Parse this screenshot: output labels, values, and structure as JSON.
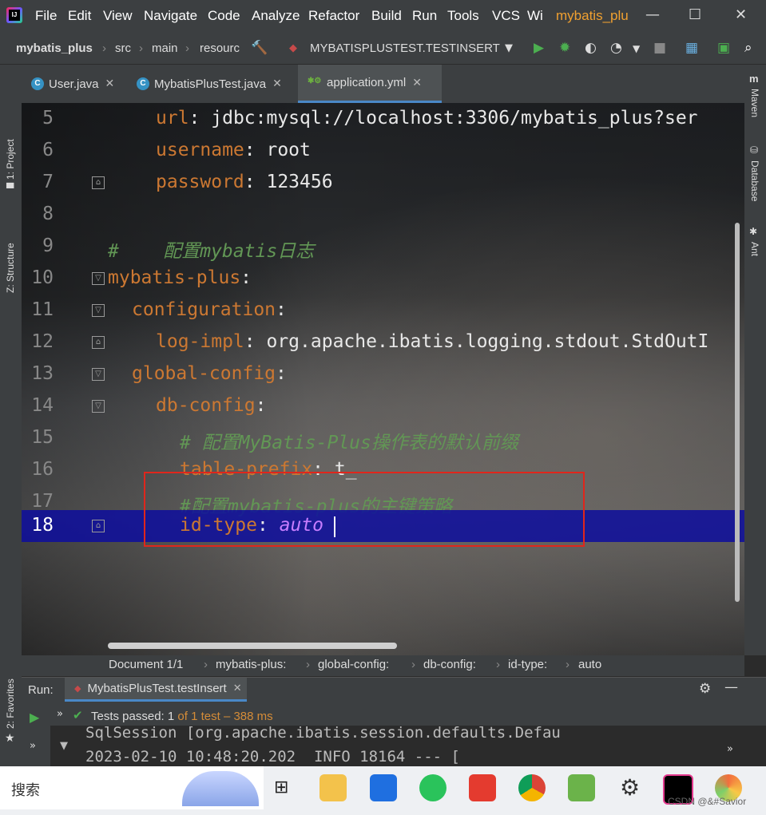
{
  "titlebar": {
    "menu": [
      "File",
      "Edit",
      "View",
      "Navigate",
      "Code",
      "Analyze",
      "Refactor",
      "Build",
      "Run",
      "Tools",
      "VCS",
      "Wi"
    ],
    "project_title": "mybatis_plu",
    "minimize": "—",
    "maximize": "☐",
    "close": "✕"
  },
  "navbar": {
    "project": "mybatis_plus",
    "crumbs": [
      "src",
      "main",
      "resourc"
    ],
    "run_config": "MYBATISPLUSTEST.TESTINSERT"
  },
  "left_stripe": {
    "project": "1: Project",
    "structure": "Z: Structure",
    "favorites": "2: Favorites"
  },
  "right_stripe": {
    "maven": "Maven",
    "database": "Database",
    "ant": "Ant"
  },
  "tabs": [
    {
      "label": "User.java",
      "icon": "C"
    },
    {
      "label": "MybatisPlusTest.java",
      "icon": "C"
    },
    {
      "label": "application.yml",
      "icon": "yml"
    }
  ],
  "editor": {
    "lines": [
      {
        "num": "5",
        "key": "url",
        "value": " jdbc:mysql://localhost:3306/mybatis_plus?ser"
      },
      {
        "num": "6",
        "key": "username",
        "value": " root"
      },
      {
        "num": "7",
        "key": "password",
        "value": " 123456"
      },
      {
        "num": "8"
      },
      {
        "num": "9",
        "comment": "#    配置mybatis日志"
      },
      {
        "num": "10",
        "key": "mybatis-plus",
        "value": ""
      },
      {
        "num": "11",
        "key": "configuration",
        "value": ""
      },
      {
        "num": "12",
        "key": "log-impl",
        "value": " org.apache.ibatis.logging.stdout.StdOutI"
      },
      {
        "num": "13",
        "key": "global-config",
        "value": ""
      },
      {
        "num": "14",
        "key": "db-config",
        "value": ""
      },
      {
        "num": "15",
        "comment": "# 配置MyBatis-Plus操作表的默认前缀"
      },
      {
        "num": "16",
        "key": "table-prefix",
        "value": " t_"
      },
      {
        "num": "17",
        "comment": "#配置mybatis-plus的主键策略"
      },
      {
        "num": "18",
        "key": "id-type",
        "value": "auto"
      }
    ]
  },
  "breadcrumbs": [
    "Document 1/1",
    "mybatis-plus:",
    "global-config:",
    "db-config:",
    "id-type:",
    "auto"
  ],
  "run_panel": {
    "label": "Run:",
    "tab": "MybatisPlusTest.testInsert",
    "tests_passed": "Tests passed: 1",
    "tests_detail": "of 1 test – 388 ms",
    "console_line1": "SqlSession [org.apache.ibatis.session.defaults.Defau",
    "console_line2": "2023-02-10 10:48:20.202  INFO 18164 --- [          "
  },
  "taskbar": {
    "search": "搜索",
    "watermark": "CSDN @&#Savior"
  },
  "colors": {
    "keyword": "#cc7832",
    "comment": "#629755",
    "constant": "#c77dff",
    "highlight": "#e0261c",
    "current_line": "#0d0d9e"
  }
}
